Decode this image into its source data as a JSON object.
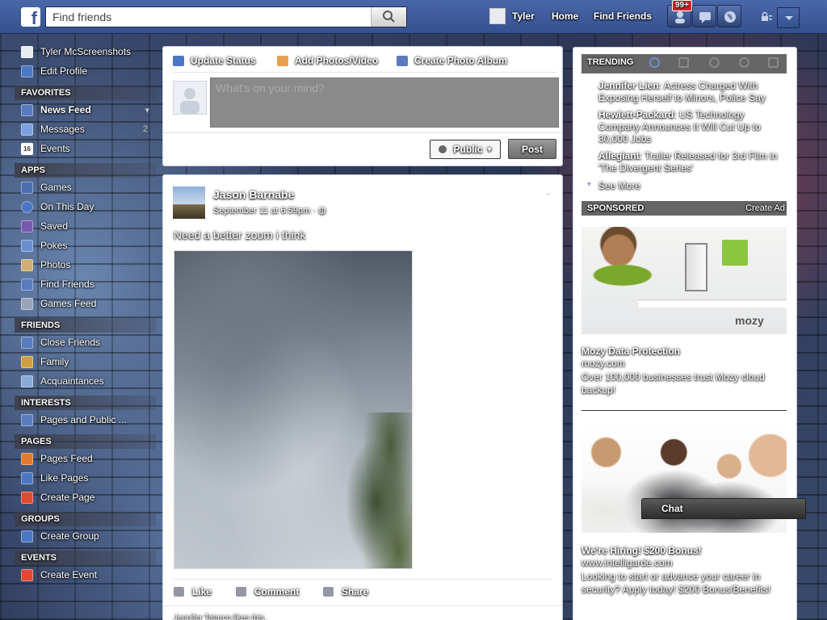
{
  "colors": {
    "fb_blue": "#3b5998",
    "topbar": "#4a67a8",
    "notif_red": "#e0202a",
    "mozy_green": "#8cc63f"
  },
  "topbar": {
    "logo": "f",
    "search_placeholder": "Find friends",
    "user_name": "Tyler",
    "home": "Home",
    "find_friends": "Find Friends",
    "notif_count": "99+"
  },
  "leftnav": {
    "profile_name": "Tyler McScreenshots",
    "edit_profile": "Edit Profile",
    "sections": {
      "favorites": "FAVORITES",
      "apps": "APPS",
      "friends": "FRIENDS",
      "interests": "INTERESTS",
      "pages": "PAGES",
      "groups": "GROUPS",
      "events": "EVENTS"
    },
    "favorites": [
      {
        "label": "News Feed",
        "icon": "news-feed-icon"
      },
      {
        "label": "Messages",
        "icon": "messages-icon",
        "count": "2"
      },
      {
        "label": "Events",
        "icon": "calendar-icon",
        "icon_text": "16"
      }
    ],
    "apps": [
      {
        "label": "Games",
        "icon": "games-icon"
      },
      {
        "label": "On This Day",
        "icon": "on-this-day-icon"
      },
      {
        "label": "Saved",
        "icon": "saved-icon"
      },
      {
        "label": "Pokes",
        "icon": "pokes-icon"
      },
      {
        "label": "Photos",
        "icon": "photos-icon"
      },
      {
        "label": "Find Friends",
        "icon": "find-friends-icon"
      },
      {
        "label": "Games Feed",
        "icon": "games-feed-icon"
      }
    ],
    "friends": [
      {
        "label": "Close Friends",
        "icon": "close-friends-icon"
      },
      {
        "label": "Family",
        "icon": "family-icon"
      },
      {
        "label": "Acquaintances",
        "icon": "acquaintances-icon"
      }
    ],
    "interests": [
      {
        "label": "Pages and Public ...",
        "icon": "rss-icon"
      }
    ],
    "pages": [
      {
        "label": "Pages Feed",
        "icon": "pages-feed-icon"
      },
      {
        "label": "Like Pages",
        "icon": "like-pages-icon"
      },
      {
        "label": "Create Page",
        "icon": "create-page-icon"
      }
    ],
    "groups": [
      {
        "label": "Create Group",
        "icon": "create-group-icon"
      }
    ],
    "events": [
      {
        "label": "Create Event",
        "icon": "create-event-icon"
      }
    ]
  },
  "composer": {
    "tab_status": "Update Status",
    "tab_photos": "Add Photos/Video",
    "tab_album": "Create Photo Album",
    "placeholder": "What's on your mind?",
    "privacy": "Public",
    "post": "Post"
  },
  "post": {
    "author": "Jason Barnabe",
    "time": "September 11 at 6:59pm",
    "text": "Need a better zoom i think",
    "like": "Like",
    "comment": "Comment",
    "share": "Share",
    "likes_line": "Jennifer Tatarco likes this."
  },
  "trending": {
    "header": "TRENDING",
    "items": [
      {
        "name": "Jennifer Lien",
        "desc": ": Actress Charged With Exposing Herself to Minors, Police Say"
      },
      {
        "name": "Hewlett-Packard",
        "desc": ": US Technology Company Announces It Will Cut Up to 30,000 Jobs"
      },
      {
        "name": "Allegiant",
        "desc": ": Trailer Released for 3rd Film in 'The Divergent Series'"
      }
    ],
    "see_more": "See More"
  },
  "sponsored": {
    "header": "SPONSORED",
    "create_ad": "Create Ad",
    "ads": [
      {
        "title": "Mozy Data Protection",
        "url": "mozy.com",
        "body": "Over 100,000 businesses trust Mozy cloud backup!",
        "logo_text": "mozy"
      },
      {
        "title": "We're Hiring! $200 Bonus!",
        "url": "www.intelligarde.com",
        "body": "Looking to start or advance your career in security? Apply today! $200 Bonus/Benefits!"
      }
    ]
  },
  "chat": {
    "label": "Chat"
  }
}
